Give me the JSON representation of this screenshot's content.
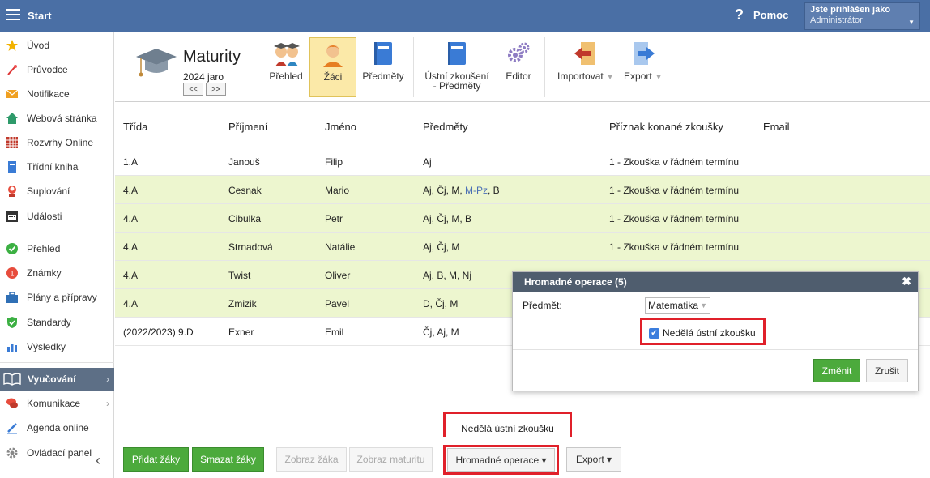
{
  "topbar": {
    "start_label": "Start",
    "help_icon": "question-icon",
    "help_label": "Pomoc",
    "user_line1": "Jste přihlášen jako",
    "user_line2": "Administrátor"
  },
  "sidebar": {
    "items": [
      {
        "label": "Úvod",
        "icon": "star-icon"
      },
      {
        "label": "Průvodce",
        "icon": "wand-icon"
      },
      {
        "label": "Notifikace",
        "icon": "envelope-icon"
      },
      {
        "label": "Webová stránka",
        "icon": "home-icon"
      },
      {
        "label": "Rozvrhy Online",
        "icon": "calendar-grid-icon"
      },
      {
        "label": "Třídní kniha",
        "icon": "book-icon"
      },
      {
        "label": "Suplování",
        "icon": "person-icon"
      },
      {
        "label": "Události",
        "icon": "calendar-icon"
      },
      {
        "label": "Přehled",
        "icon": "check-circle-icon"
      },
      {
        "label": "Známky",
        "icon": "grade-icon"
      },
      {
        "label": "Plány a přípravy",
        "icon": "briefcase-icon"
      },
      {
        "label": "Standardy",
        "icon": "shield-check-icon"
      },
      {
        "label": "Výsledky",
        "icon": "bar-chart-icon"
      },
      {
        "label": "Vyučování",
        "icon": "open-book-icon"
      },
      {
        "label": "Komunikace",
        "icon": "chat-icon"
      },
      {
        "label": "Agenda online",
        "icon": "pen-icon"
      },
      {
        "label": "Ovládací panel",
        "icon": "gear-icon"
      }
    ]
  },
  "ribbon": {
    "title": "Maturity",
    "year": "2024 jaro",
    "prev_label": "<<",
    "next_label": ">>",
    "buttons": {
      "prehled": "Přehled",
      "zaci": "Žáci",
      "predmety": "Předměty",
      "ustni_line1": "Ústní zkoušení",
      "ustni_line2": "- Předměty",
      "editor": "Editor",
      "importovat": "Importovat",
      "export": "Export"
    },
    "dropdown_glyph": "▼"
  },
  "table": {
    "headers": [
      "Třída",
      "Příjmení",
      "Jméno",
      "Předměty",
      "Příznak konané zkoušky",
      "Email"
    ],
    "rows": [
      {
        "trida": "1.A",
        "prijmeni": "Janouš",
        "jmeno": "Filip",
        "predmety": "Aj",
        "priznak": "1 - Zkouška v řádném termínu",
        "highlighted": false
      },
      {
        "trida": "4.A",
        "prijmeni": "Cesnak",
        "jmeno": "Mario",
        "predmety_a": "Aj, Čj, M, ",
        "predmety_b": "M-Pz",
        "predmety_c": ", B",
        "priznak": "1 - Zkouška v řádném termínu",
        "highlighted": true
      },
      {
        "trida": "4.A",
        "prijmeni": "Cibulka",
        "jmeno": "Petr",
        "predmety": "Aj, Čj, M, B",
        "priznak": "1 - Zkouška v řádném termínu",
        "highlighted": true
      },
      {
        "trida": "4.A",
        "prijmeni": "Strnadová",
        "jmeno": "Natálie",
        "predmety": "Aj, Čj, M",
        "priznak": "1 - Zkouška v řádném termínu",
        "highlighted": true
      },
      {
        "trida": "4.A",
        "prijmeni": "Twist",
        "jmeno": "Oliver",
        "predmety": "Aj, B, M, Nj",
        "priznak": "",
        "highlighted": true
      },
      {
        "trida": "4.A",
        "prijmeni": "Zmizik",
        "jmeno": "Pavel",
        "predmety": "D, Čj, M",
        "priznak": "",
        "highlighted": true
      },
      {
        "trida": "(2022/2023) 9.D",
        "prijmeni": "Exner",
        "jmeno": "Emil",
        "predmety": "Čj, Aj, M",
        "priznak": "",
        "highlighted": false
      }
    ]
  },
  "modal": {
    "title": "Hromadné operace (5)",
    "close_glyph": "✖",
    "predmet_label": "Předmět:",
    "predmet_value": "Matematika",
    "checkbox_label": "Nedělá ústní zkoušku",
    "checkbox_checked": true,
    "submit_label": "Změnit",
    "cancel_label": "Zrušit"
  },
  "tooltip": {
    "text": "Nedělá ústní zkoušku"
  },
  "footer": {
    "add_label": "Přidat žáky",
    "delete_label": "Smazat žáky",
    "show_student_label": "Zobraz žáka",
    "show_exam_label": "Zobraz maturitu",
    "bulk_label": "Hromadné operace ▾",
    "export_label": "Export ▾"
  },
  "colors": {
    "topbar": "#4a6fa5",
    "highlight_row": "#edf6cf",
    "accent_green": "#4caa3c",
    "callout_red": "#e0202a",
    "sidebar_active": "#5d6f86"
  }
}
